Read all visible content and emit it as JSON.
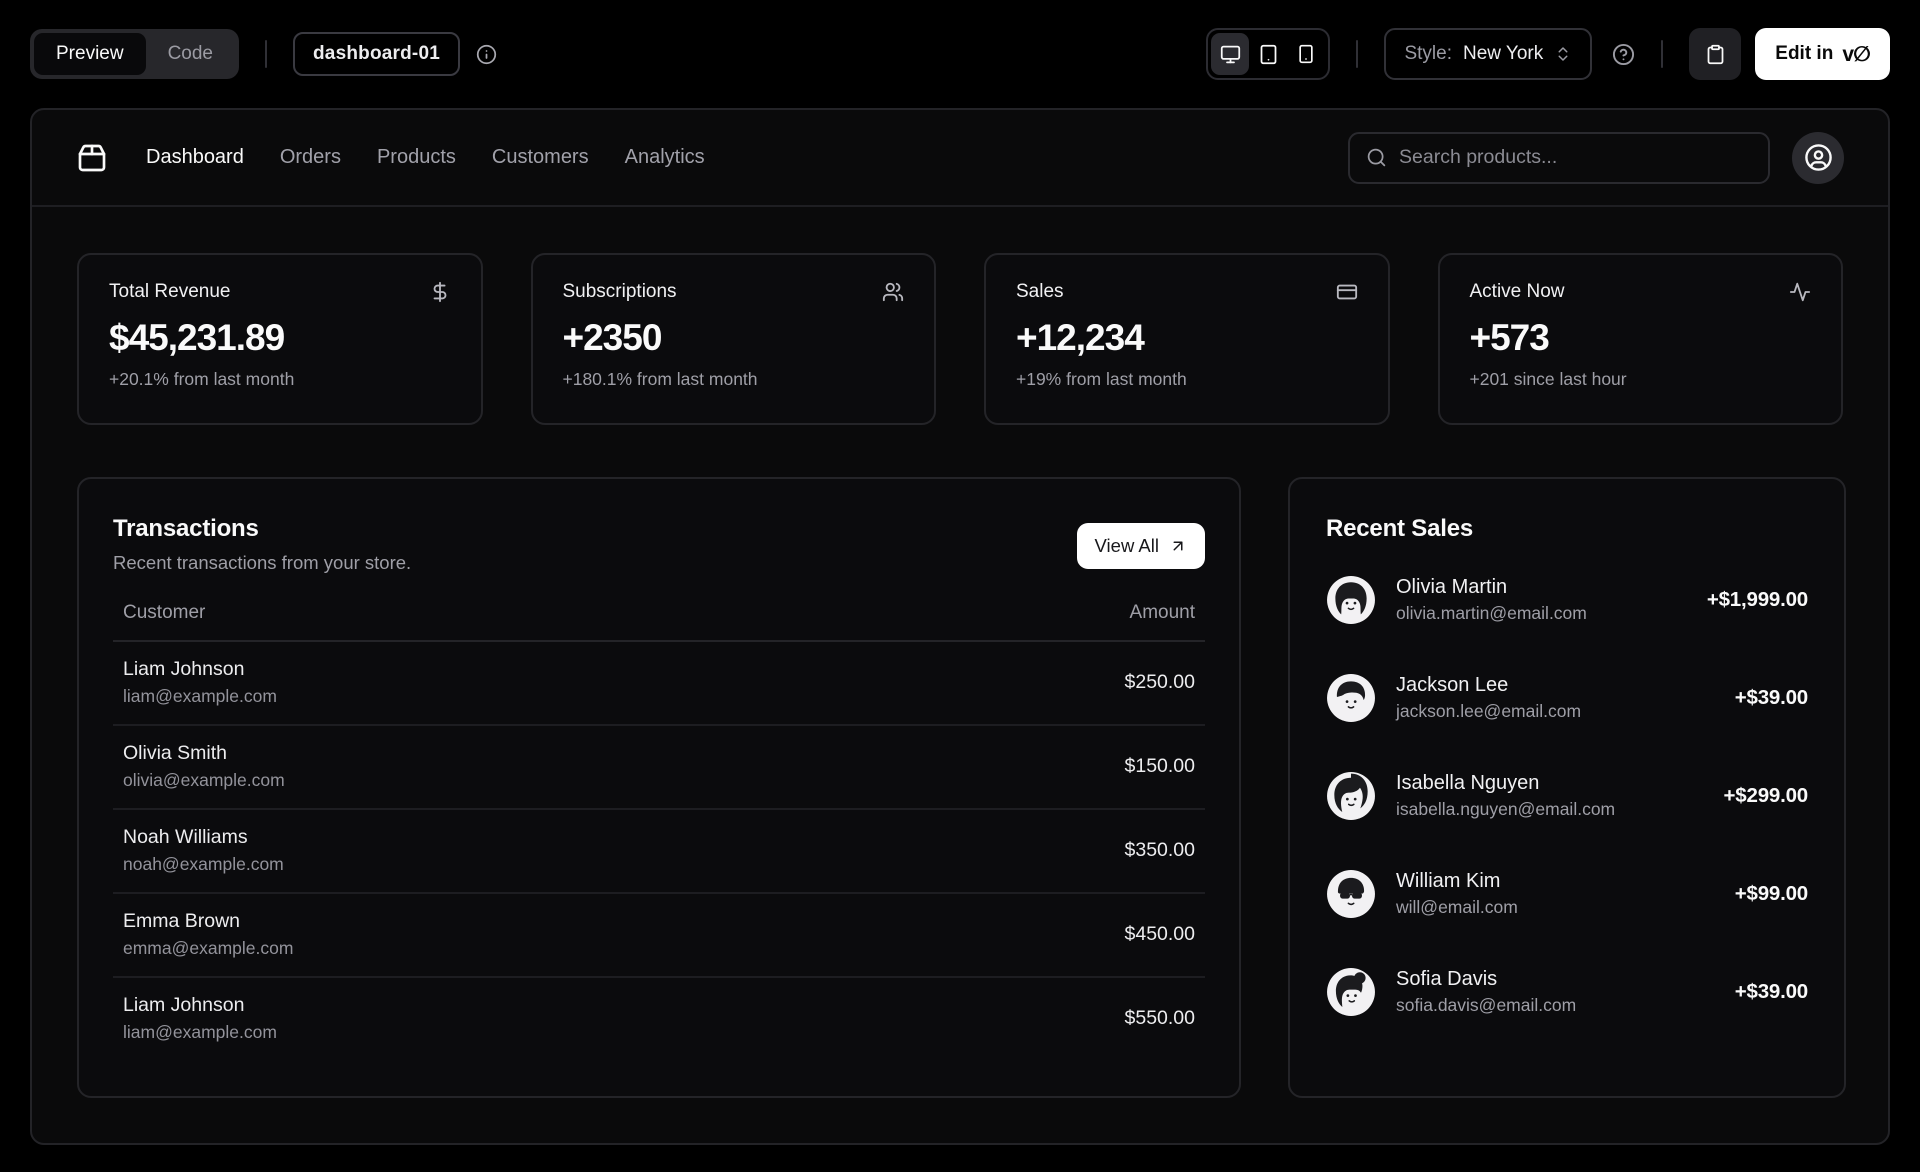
{
  "toolbar": {
    "preview_label": "Preview",
    "code_label": "Code",
    "block_name": "dashboard-01",
    "style_label": "Style:",
    "style_value": "New York",
    "edit_label": "Edit in",
    "v0_logo_glyph": "v∅"
  },
  "navbar": {
    "links": [
      "Dashboard",
      "Orders",
      "Products",
      "Customers",
      "Analytics"
    ],
    "active_link": "Dashboard",
    "search_placeholder": "Search products..."
  },
  "stats": [
    {
      "title": "Total Revenue",
      "icon": "dollar-sign-icon",
      "value": "$45,231.89",
      "change": "+20.1% from last month"
    },
    {
      "title": "Subscriptions",
      "icon": "users-icon",
      "value": "+2350",
      "change": "+180.1% from last month"
    },
    {
      "title": "Sales",
      "icon": "credit-card-icon",
      "value": "+12,234",
      "change": "+19% from last month"
    },
    {
      "title": "Active Now",
      "icon": "activity-icon",
      "value": "+573",
      "change": "+201 since last hour"
    }
  ],
  "transactions": {
    "title": "Transactions",
    "subtitle": "Recent transactions from your store.",
    "view_all_label": "View All",
    "columns": [
      "Customer",
      "Amount"
    ],
    "rows": [
      {
        "name": "Liam Johnson",
        "email": "liam@example.com",
        "amount": "$250.00"
      },
      {
        "name": "Olivia Smith",
        "email": "olivia@example.com",
        "amount": "$150.00"
      },
      {
        "name": "Noah Williams",
        "email": "noah@example.com",
        "amount": "$350.00"
      },
      {
        "name": "Emma Brown",
        "email": "emma@example.com",
        "amount": "$450.00"
      },
      {
        "name": "Liam Johnson",
        "email": "liam@example.com",
        "amount": "$550.00"
      }
    ]
  },
  "recent_sales": {
    "title": "Recent Sales",
    "items": [
      {
        "name": "Olivia Martin",
        "email": "olivia.martin@email.com",
        "amount": "+$1,999.00"
      },
      {
        "name": "Jackson Lee",
        "email": "jackson.lee@email.com",
        "amount": "+$39.00"
      },
      {
        "name": "Isabella Nguyen",
        "email": "isabella.nguyen@email.com",
        "amount": "+$299.00"
      },
      {
        "name": "William Kim",
        "email": "will@email.com",
        "amount": "+$99.00"
      },
      {
        "name": "Sofia Davis",
        "email": "sofia.davis@email.com",
        "amount": "+$39.00"
      }
    ]
  },
  "colors": {
    "page_bg": "#000000",
    "panel_bg": "#0a0a0b",
    "card_border": "#242428",
    "foreground": "#fafafa",
    "muted": "#9f9fa7",
    "accent_button": "#ffffff"
  }
}
